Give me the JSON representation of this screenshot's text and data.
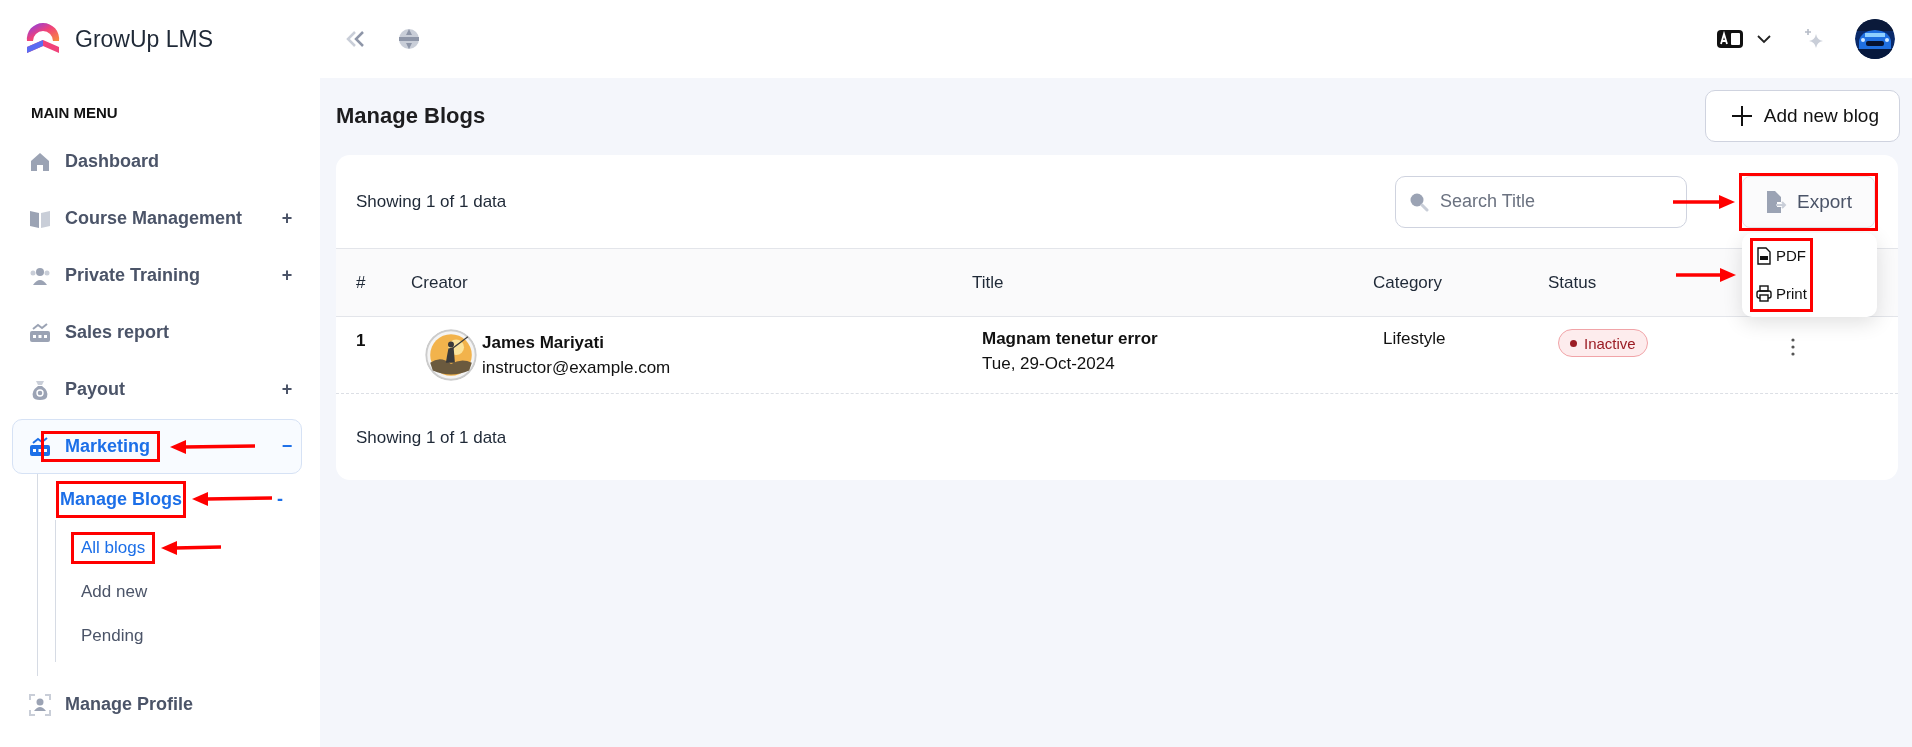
{
  "brand": {
    "name": "GrowUp LMS"
  },
  "sidebar": {
    "heading": "MAIN MENU",
    "items": [
      {
        "label": "Dashboard",
        "selected": false
      },
      {
        "label": "Course Management",
        "toggle": "+",
        "selected": false
      },
      {
        "label": "Private Training",
        "toggle": "+",
        "selected": false
      },
      {
        "label": "Sales report",
        "selected": false
      },
      {
        "label": "Payout",
        "toggle": "+",
        "selected": false
      },
      {
        "label": "Marketing",
        "toggle": "−",
        "selected": true,
        "highlighted": true,
        "children": [
          {
            "label": "Manage Blogs",
            "toggle": "-",
            "selected": true,
            "highlighted": true,
            "children": [
              {
                "label": "All blogs",
                "selected": true,
                "highlighted": true
              },
              {
                "label": "Add new",
                "selected": false
              },
              {
                "label": "Pending",
                "selected": false
              }
            ]
          }
        ]
      },
      {
        "label": "Manage Profile",
        "selected": false
      }
    ]
  },
  "page": {
    "title": "Manage Blogs",
    "add_button": "Add new blog"
  },
  "blogs": {
    "summary": "Showing 1 of 1 data",
    "search": {
      "placeholder": "Search Title"
    },
    "export": {
      "label": "Export",
      "highlighted": true,
      "open": true,
      "menu_highlighted": true,
      "options": [
        {
          "label": "PDF"
        },
        {
          "label": "Print"
        }
      ]
    },
    "table": {
      "columns": [
        "#",
        "Creator",
        "Title",
        "Category",
        "Status"
      ],
      "rows": [
        {
          "number": "1",
          "creator": {
            "name": "James Mariyati",
            "email": "instructor@example.com"
          },
          "title": "Magnam tenetur error",
          "date": "Tue, 29-Oct-2024",
          "category": "Lifestyle",
          "status": {
            "label": "Inactive",
            "kind": "inactive"
          }
        }
      ]
    },
    "footer": "Showing 1 of 1 data"
  }
}
